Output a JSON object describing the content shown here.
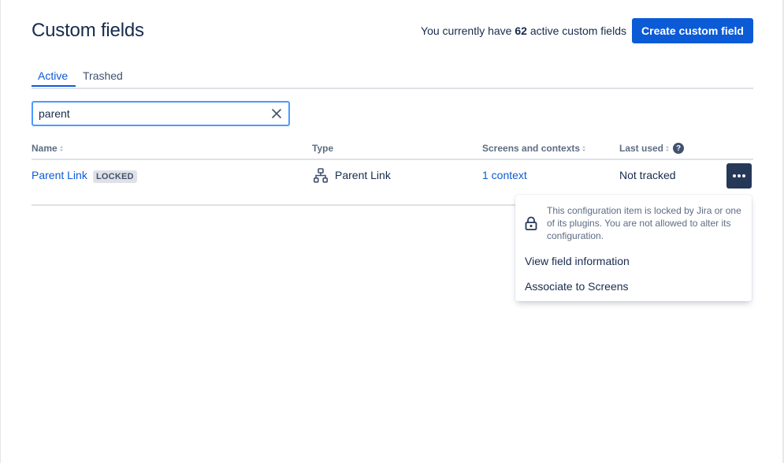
{
  "header": {
    "title": "Custom fields",
    "summary_prefix": "You currently have ",
    "summary_count": "62",
    "summary_suffix": " active custom fields",
    "create_button": "Create custom field"
  },
  "tabs": [
    {
      "label": "Active",
      "active": true
    },
    {
      "label": "Trashed",
      "active": false
    }
  ],
  "search": {
    "value": "parent"
  },
  "table": {
    "columns": [
      "Name",
      "Type",
      "Screens and contexts",
      "Last used"
    ],
    "rows": [
      {
        "name": "Parent Link",
        "badge": "LOCKED",
        "type": "Parent Link",
        "type_icon": "hierarchy-icon",
        "contexts": "1 context",
        "last_used": "Not tracked"
      }
    ]
  },
  "dropdown": {
    "lock_message": "This configuration item is locked by Jira or one of its plugins. You are not allowed to alter its configuration.",
    "items": [
      "View field information",
      "Associate to Screens"
    ]
  },
  "colors": {
    "primary": "#0c5bd6",
    "text": "#172b4d",
    "subtle": "#5e6c84",
    "more_button_bg": "#253858",
    "focus_border": "#4c9aff"
  }
}
